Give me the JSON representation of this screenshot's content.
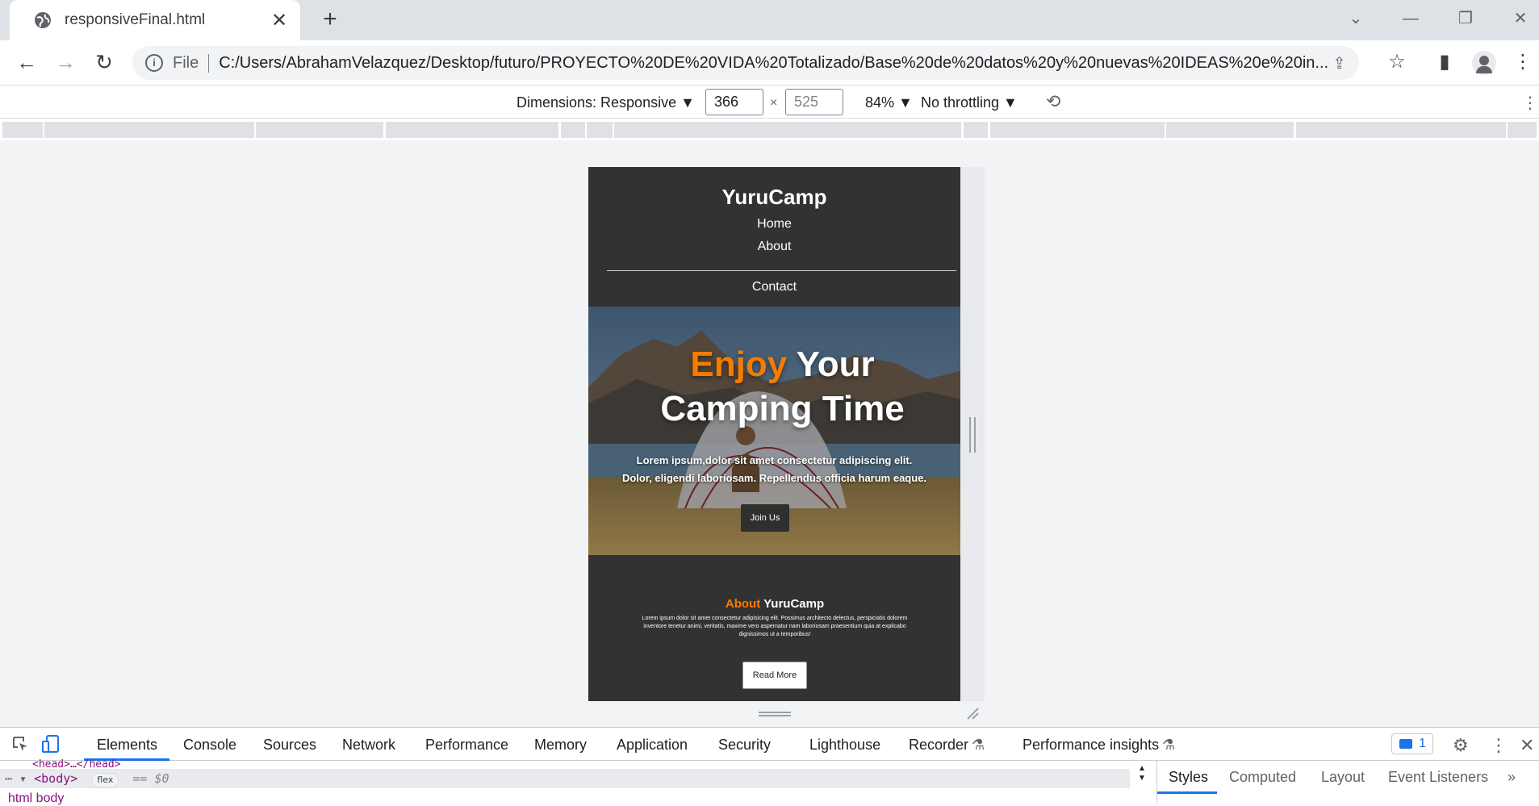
{
  "browser": {
    "tab_title": "responsiveFinal.html",
    "url_protocol": "File",
    "url": "C:/Users/AbrahamVelazquez/Desktop/futuro/PROYECTO%20DE%20VIDA%20Totalizado/Base%20de%20datos%20y%20nuevas%20IDEAS%20e%20in..."
  },
  "device_toolbar": {
    "dimensions_label": "Dimensions: Responsive ▼",
    "width": "366",
    "height": "525",
    "zoom": "84% ▼",
    "throttling": "No throttling ▼"
  },
  "site": {
    "logo": "YuruCamp",
    "nav": [
      "Home",
      "About",
      "Contact"
    ],
    "hero_title_accent": "Enjoy",
    "hero_title_rest": "Your",
    "hero_title_line2": "Camping Time",
    "hero_text_line1": "Lorem ipsum,dolor sit amet consectetur adipiscing elit.",
    "hero_text_line2": "Dolor, eligendi laboriosam. Repellendus officia harum eaque.",
    "join_button": "Join Us",
    "about_accent": "About",
    "about_rest": "YuruCamp",
    "about_text": "Lorem ipsum dolor sit amet consectetur adipisicing elit. Possimus architecto delectus, perspiciatis dolorem inventore tenetur animi, veritatis, maxime vero aspernatur nam laboriosam praesentium quia at explicabo dignissimos ut a temporibus!",
    "read_more_button": "Read More",
    "colors": {
      "accent": "#f57c00",
      "background": "#323232"
    }
  },
  "devtools": {
    "tabs": [
      "Elements",
      "Console",
      "Sources",
      "Network",
      "Performance",
      "Memory",
      "Application",
      "Security",
      "Lighthouse",
      "Recorder",
      "Performance insights"
    ],
    "issues_count": "1",
    "dom_tag": "<body>",
    "dom_badge": "flex",
    "dom_ref": "== $0",
    "dom_prev": "<head>…</head>",
    "breadcrumbs": "html   body",
    "side_tabs": [
      "Styles",
      "Computed",
      "Layout",
      "Event Listeners"
    ]
  }
}
